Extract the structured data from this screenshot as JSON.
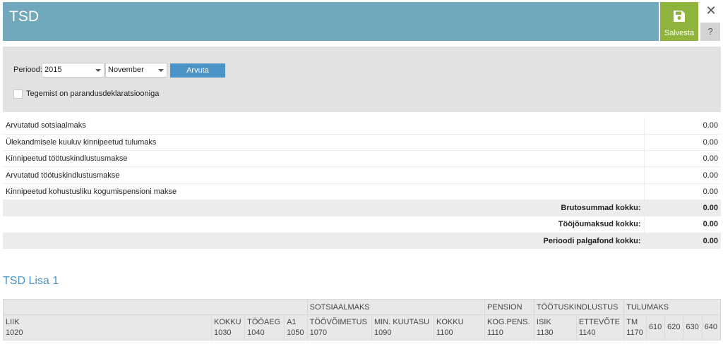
{
  "header": {
    "title": "TSD"
  },
  "toolbar": {
    "save_label": "Salvesta",
    "close_glyph": "✕",
    "help_glyph": "?"
  },
  "filter": {
    "period_label": "Periood:",
    "year": "2015",
    "month": "November",
    "calculate_label": "Arvuta",
    "correction_label": "Tegemist on parandusdeklaratsiooniga",
    "correction_checked": false
  },
  "summary": {
    "rows": [
      {
        "label": "Arvutatud sotsiaalmaks",
        "value": "0.00"
      },
      {
        "label": "Ülekandmisele kuuluv kinnipeetud tulumaks",
        "value": "0.00"
      },
      {
        "label": "Kinnipeetud töötuskindlustusmakse",
        "value": "0.00"
      },
      {
        "label": "Arvutatud töötuskindlustusmakse",
        "value": "0.00"
      },
      {
        "label": "Kinnipeetud kohustusliku kogumispensioni makse",
        "value": "0.00"
      }
    ],
    "totals": [
      {
        "label": "Brutosummad kokku:",
        "value": "0.00"
      },
      {
        "label": "Tööjõumaksud kokku:",
        "value": "0.00"
      },
      {
        "label": "Perioodi palgafond kokku:",
        "value": "0.00"
      }
    ]
  },
  "lisa": {
    "title": "TSD Lisa 1",
    "groups": {
      "sotsiaalmaks": "SOTSIAALMAKS",
      "pension": "PENSION",
      "tootuskindlustus": "TÖÖTUSKINDLUSTUS",
      "tulumaks": "TULUMAKS"
    },
    "columns": [
      {
        "name": "LIIK",
        "code": "1020"
      },
      {
        "name": "KOKKU",
        "code": "1030"
      },
      {
        "name": "TÖÖAEG",
        "code": "1040"
      },
      {
        "name": "A1",
        "code": "1050"
      },
      {
        "name": "TÖÖVÕIMETUS",
        "code": "1070"
      },
      {
        "name": "MIN. KUUTASU",
        "code": "1090"
      },
      {
        "name": "KOKKU",
        "code": "1100"
      },
      {
        "name": "KOG.PENS.",
        "code": "1110"
      },
      {
        "name": "ISIK",
        "code": "1130"
      },
      {
        "name": "ETTEVÕTE",
        "code": "1140"
      },
      {
        "name": "TM",
        "code": "1170"
      },
      {
        "name": "",
        "code": "610"
      },
      {
        "name": "",
        "code": "620"
      },
      {
        "name": "",
        "code": "630"
      },
      {
        "name": "",
        "code": "640"
      }
    ]
  },
  "colors": {
    "header": "#72a8bb",
    "save": "#8eb43d",
    "accent": "#4b94c8",
    "panel": "#e2e2e2"
  }
}
